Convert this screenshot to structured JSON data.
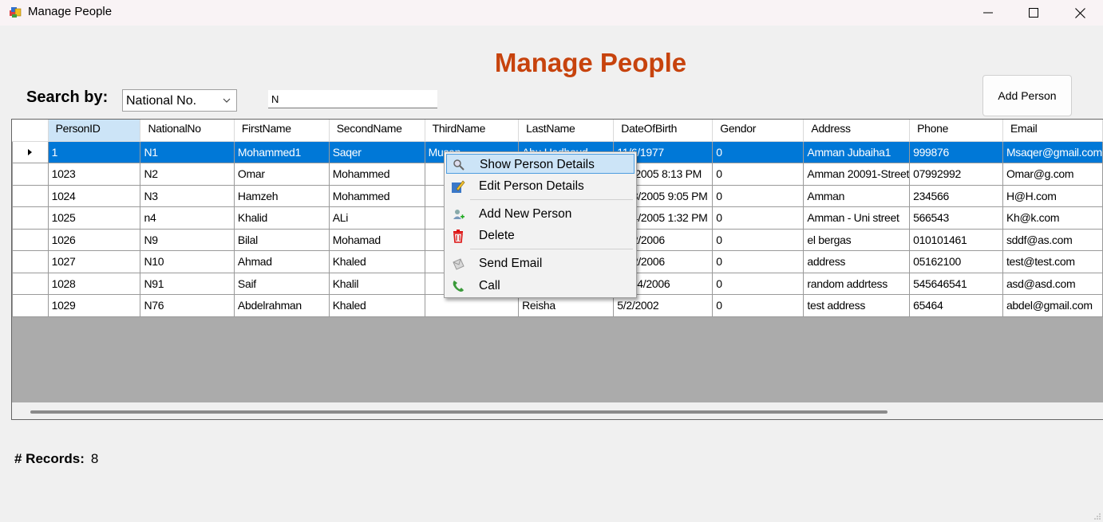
{
  "window": {
    "title": "Manage People"
  },
  "heading": "Manage People",
  "search": {
    "label": "Search by:",
    "filter_value": "National No.",
    "query_value": "N"
  },
  "add_button_label": "Add Person",
  "table": {
    "columns": [
      "PersonID",
      "NationalNo",
      "FirstName",
      "SecondName",
      "ThirdName",
      "LastName",
      "DateOfBirth",
      "Gendor",
      "Address",
      "Phone",
      "Email"
    ],
    "rows": [
      [
        "1",
        "N1",
        "Mohammed1",
        "Saqer",
        "Musan",
        "Abu Hadhoud",
        "11/6/1977",
        "0",
        "Amman Jubaiha1",
        "999876",
        "Msaqer@gmail.com"
      ],
      [
        "1023",
        "N2",
        "Omar",
        "Mohammed",
        "",
        "",
        "6/1/2005 8:13 PM",
        "0",
        "Amman 20091-Street",
        "07992992",
        "Omar@g.com"
      ],
      [
        "1024",
        "N3",
        "Hamzeh",
        "Mohammed",
        "",
        "",
        "9/23/2005 9:05 PM",
        "0",
        "Amman",
        "234566",
        "H@H.com"
      ],
      [
        "1025",
        "n4",
        "Khalid",
        "ALi",
        "",
        "",
        "9/24/2005 1:32 PM",
        "0",
        "Amman - Uni street",
        "566543",
        "Kh@k.com"
      ],
      [
        "1026",
        "N9",
        "Bilal",
        "Mohamad",
        "",
        "",
        "7/12/2006",
        "0",
        "el bergas",
        "010101461",
        "sddf@as.com"
      ],
      [
        "1027",
        "N10",
        "Ahmad",
        "Khaled",
        "",
        "",
        "6/12/2006",
        "0",
        "address",
        "05162100",
        "test@test.com"
      ],
      [
        "1028",
        "N91",
        "Saif",
        "Khalil",
        "",
        "",
        "11/14/2006",
        "0",
        "random addrtess",
        "545646541",
        "asd@asd.com"
      ],
      [
        "1029",
        "N76",
        "Abdelrahman",
        "Khaled",
        "",
        "Reisha",
        "5/2/2002",
        "0",
        "test address",
        "65464",
        "abdel@gmail.com"
      ]
    ],
    "selected_row": 0
  },
  "context_menu": {
    "items": [
      {
        "label": "Show Person Details",
        "icon": "magnifier-icon",
        "highlighted": true
      },
      {
        "label": "Edit Person Details",
        "icon": "edit-pencil-icon"
      },
      {
        "label": "Add New Person",
        "icon": "add-person-icon"
      },
      {
        "label": "Delete",
        "icon": "trash-icon"
      },
      {
        "label": "Send Email",
        "icon": "envelope-icon"
      },
      {
        "label": "Call",
        "icon": "phone-icon"
      }
    ]
  },
  "records": {
    "label": "# Records:",
    "count": "8"
  },
  "colors": {
    "heading": "#c7430d",
    "selection": "#0078d7",
    "menu_highlight": "#cce4f7"
  }
}
